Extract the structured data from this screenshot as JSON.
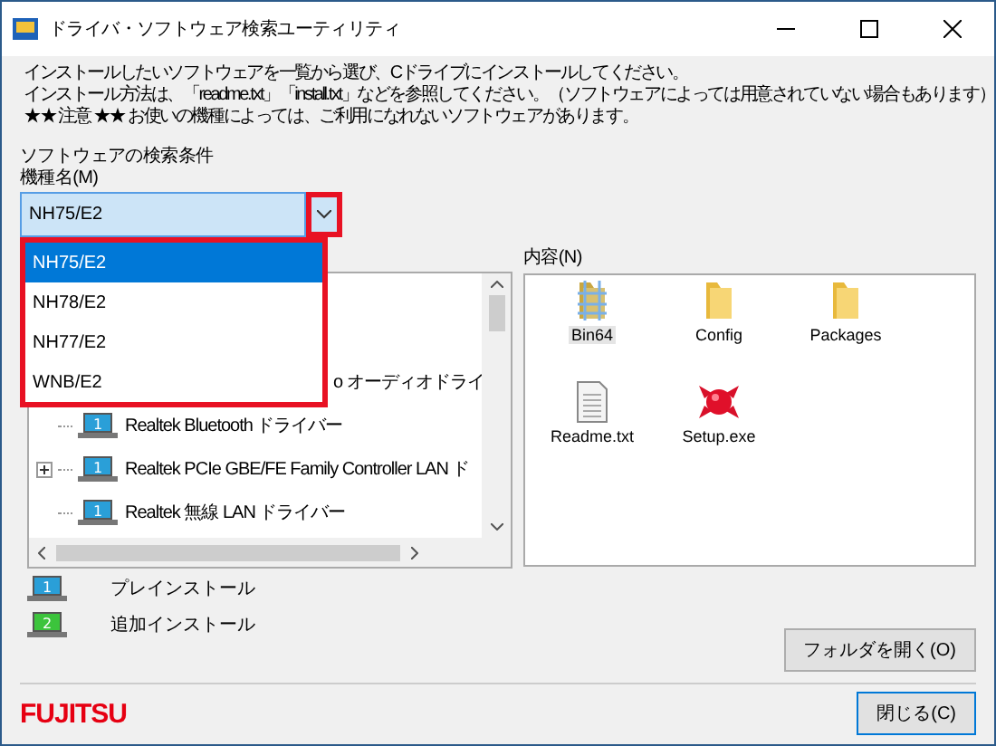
{
  "window": {
    "title": "ドライバ・ソフトウェア検索ユーティリティ"
  },
  "instructions": [
    "インストールしたいソフトウェアを一覧から選び、Cドライブにインストールしてください。",
    "インストール方法は、「readme.txt」「install.txt」などを参照してください。（ソフトウェアによっては用意されていない場合もあります）",
    "★★ 注意 ★★ お使いの機種によっては、ご利用になれないソフトウェアがあります。"
  ],
  "search_label": "ソフトウェアの検索条件",
  "model": {
    "label": "機種名(M)",
    "value": "NH75/E2",
    "expanded": true,
    "options": [
      {
        "label": "NH75/E2",
        "selected": true
      },
      {
        "label": "NH78/E2",
        "selected": false
      },
      {
        "label": "NH77/E2",
        "selected": false
      },
      {
        "label": "WNB/E2",
        "selected": false
      }
    ]
  },
  "tree": [
    {
      "label": "o オーディオドライ",
      "partial": true
    },
    {
      "label": "Realtek Bluetooth ドライバー",
      "number": "1",
      "expandable": false,
      "partial": false
    },
    {
      "label": "Realtek PCIe GBE/FE Family Controller LAN ド",
      "number": "1",
      "expandable": true,
      "partial": false
    },
    {
      "label": "Realtek 無線 LAN ドライバー",
      "number": "1",
      "expandable": false,
      "partial": false
    }
  ],
  "contents": {
    "label": "内容(N)",
    "items": [
      {
        "name": "Bin64",
        "kind": "bin",
        "selected": true
      },
      {
        "name": "Config",
        "kind": "folder",
        "selected": false
      },
      {
        "name": "Packages",
        "kind": "folder",
        "selected": false
      },
      {
        "name": "Readme.txt",
        "kind": "text",
        "selected": false
      },
      {
        "name": "Setup.exe",
        "kind": "setup",
        "selected": false
      }
    ]
  },
  "legend": [
    {
      "label": "プレインストール",
      "number": "1",
      "color": "#2a9fd8"
    },
    {
      "label": "追加インストール",
      "number": "2",
      "color": "#3cc43c"
    }
  ],
  "buttons": {
    "open_folder": "フォルダを開く(O)",
    "close": "閉じる(C)"
  },
  "logo": "FUJITSU"
}
